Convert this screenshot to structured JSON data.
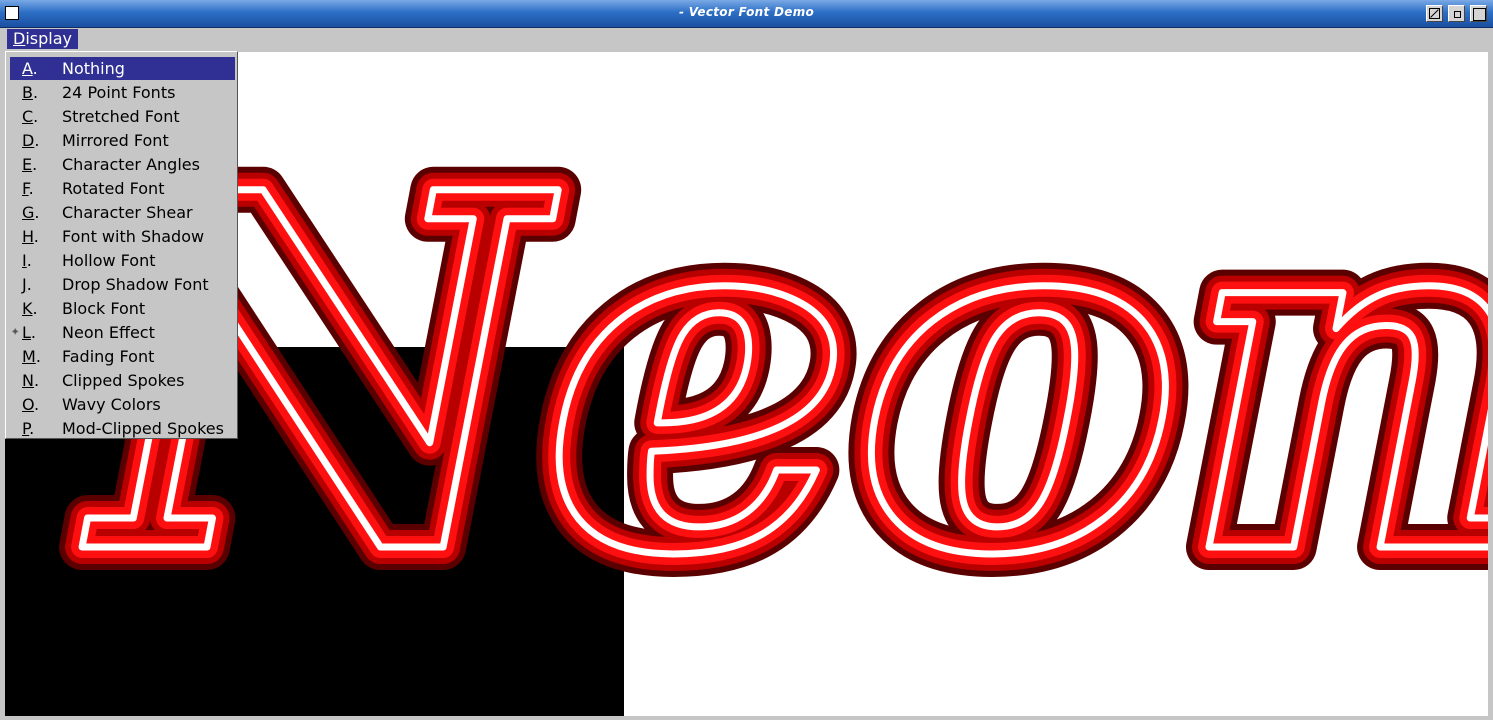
{
  "window": {
    "title": "- Vector Font Demo"
  },
  "menubar": {
    "display_label_ul": "D",
    "display_label_rest": "isplay"
  },
  "canvas": {
    "text": "Neon",
    "colors": {
      "outer": "#5a0000",
      "mid": "#b80000",
      "bright": "#ff1010",
      "core": "#ffffff",
      "background": "#ffffff",
      "block": "#000000"
    }
  },
  "menu": {
    "items": [
      {
        "key": "A",
        "label": "Nothing",
        "selected": true,
        "checked": false
      },
      {
        "key": "B",
        "label": "24 Point Fonts",
        "selected": false,
        "checked": false
      },
      {
        "key": "C",
        "label": "Stretched Font",
        "selected": false,
        "checked": false
      },
      {
        "key": "D",
        "label": "Mirrored Font",
        "selected": false,
        "checked": false
      },
      {
        "key": "E",
        "label": "Character Angles",
        "selected": false,
        "checked": false
      },
      {
        "key": "F",
        "label": "Rotated Font",
        "selected": false,
        "checked": false
      },
      {
        "key": "G",
        "label": "Character Shear",
        "selected": false,
        "checked": false
      },
      {
        "key": "H",
        "label": "Font with Shadow",
        "selected": false,
        "checked": false
      },
      {
        "key": "I",
        "label": "Hollow Font",
        "selected": false,
        "checked": false
      },
      {
        "key": "J",
        "label": "Drop Shadow Font",
        "selected": false,
        "checked": false
      },
      {
        "key": "K",
        "label": "Block Font",
        "selected": false,
        "checked": false
      },
      {
        "key": "L",
        "label": "Neon Effect",
        "selected": false,
        "checked": true
      },
      {
        "key": "M",
        "label": "Fading Font",
        "selected": false,
        "checked": false
      },
      {
        "key": "N",
        "label": "Clipped Spokes",
        "selected": false,
        "checked": false
      },
      {
        "key": "O",
        "label": "Wavy Colors",
        "selected": false,
        "checked": false
      },
      {
        "key": "P",
        "label": "Mod-Clipped Spokes",
        "selected": false,
        "checked": false
      }
    ],
    "check_glyph": "✦"
  }
}
